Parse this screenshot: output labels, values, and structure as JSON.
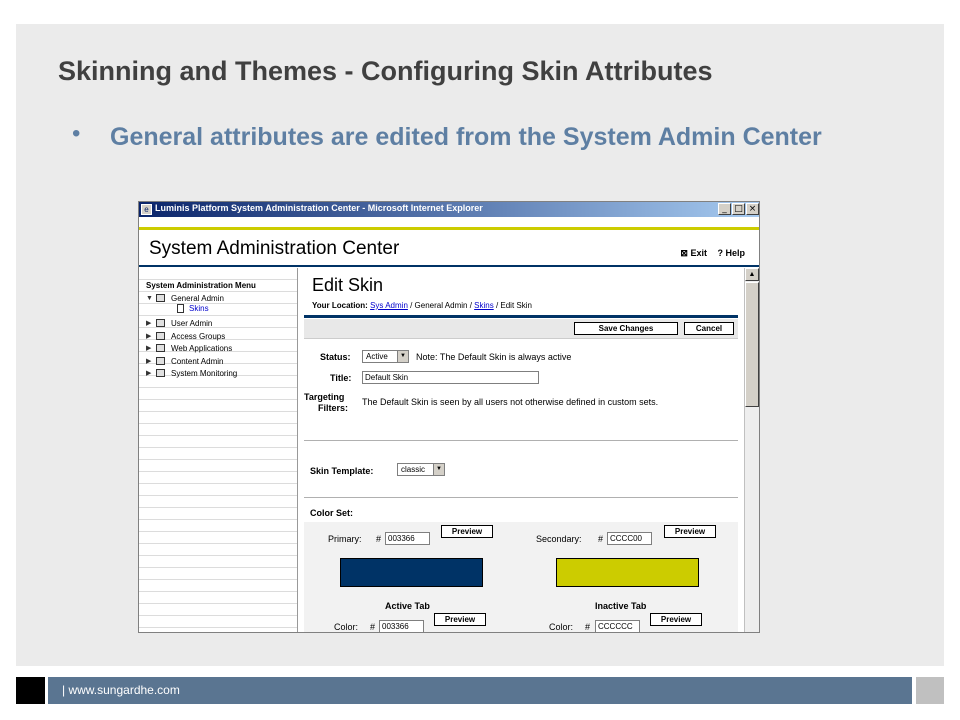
{
  "slide": {
    "title": "Skinning and Themes - Configuring Skin Attributes",
    "bullet": "General attributes are edited from the System Admin Center",
    "bullet_glyph": "•"
  },
  "window": {
    "title": "Luminis Platform System Administration Center - Microsoft Internet Explorer",
    "minimize": "_",
    "maximize": "□",
    "close": "×"
  },
  "app": {
    "header": "System Administration Center",
    "exit_label": "Exit",
    "help_label": "Help"
  },
  "menu": {
    "heading": "System Administration Menu",
    "items": [
      {
        "label": "General Admin",
        "expanded": true
      },
      {
        "label": "User Admin",
        "expanded": false
      },
      {
        "label": "Access Groups",
        "expanded": false
      },
      {
        "label": "Web Applications",
        "expanded": false
      },
      {
        "label": "Content Admin",
        "expanded": false
      },
      {
        "label": "System Monitoring",
        "expanded": false
      }
    ],
    "sub_item": "Skins"
  },
  "edit": {
    "title": "Edit Skin",
    "location_label": "Your Location:",
    "crumb_sysadmin": "Sys Admin",
    "crumb_sep1": " / General Admin / ",
    "crumb_skins": "Skins",
    "crumb_sep2": " / Edit Skin",
    "save_button": "Save Changes",
    "cancel_button": "Cancel",
    "status_label": "Status:",
    "status_value": "Active",
    "status_note": "Note: The Default Skin is always active",
    "title_label": "Title:",
    "title_value": "Default Skin",
    "targeting_label_1": "Targeting",
    "targeting_label_2": "Filters:",
    "targeting_text": "The Default Skin is seen by all users not otherwise defined in custom sets.",
    "template_label": "Skin Template:",
    "template_value": "classic",
    "colorset_label": "Color Set:"
  },
  "colors": {
    "primary_label": "Primary:",
    "primary_value": "003366",
    "primary_hex": "#003366",
    "secondary_label": "Secondary:",
    "secondary_value": "CCCC00",
    "secondary_hex": "#cccc00",
    "hash": "#",
    "preview": "Preview",
    "active_tab_label": "Active Tab",
    "active_tab_color_label": "Color:",
    "active_tab_value": "003366",
    "inactive_tab_label": "Inactive Tab",
    "inactive_tab_color_label": "Color:",
    "inactive_tab_value": "CCCCCC"
  },
  "footer": {
    "text": "| www.sungardhe.com"
  }
}
